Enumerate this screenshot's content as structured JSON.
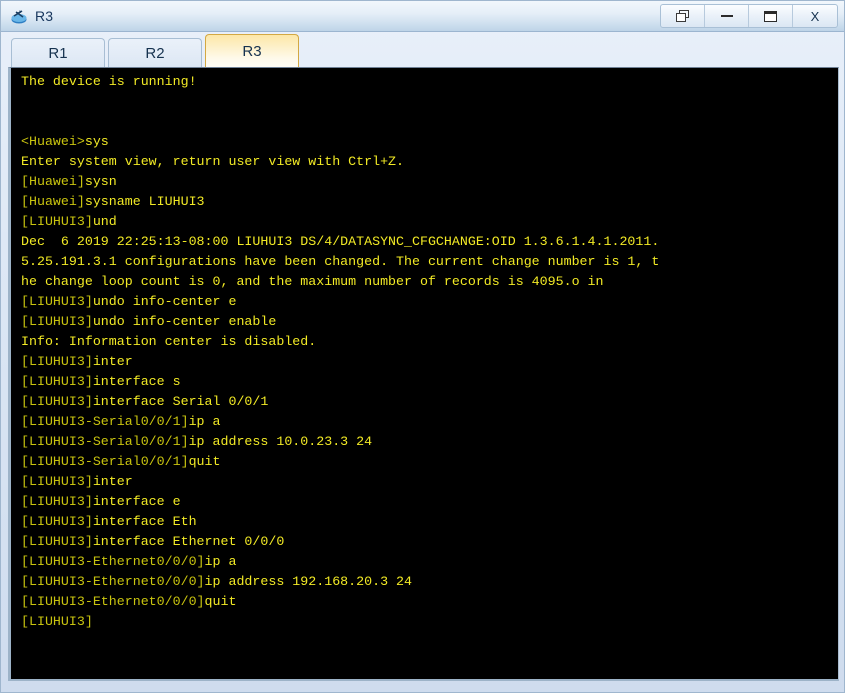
{
  "window": {
    "title": "R3",
    "icon": "router-icon",
    "controls": [
      {
        "name": "restore-button",
        "icon": "restore-icon",
        "label": ""
      },
      {
        "name": "minimize-button",
        "icon": "minimize-icon",
        "label": ""
      },
      {
        "name": "maximize-button",
        "icon": "maximize-icon",
        "label": ""
      },
      {
        "name": "close-button",
        "icon": "close-icon",
        "label": "X"
      }
    ]
  },
  "tabs": [
    {
      "label": "R1",
      "active": false
    },
    {
      "label": "R2",
      "active": false
    },
    {
      "label": "R3",
      "active": true
    }
  ],
  "terminal": {
    "colors": {
      "background": "#000000",
      "output_text": "#f2ea25",
      "prompt_text": "#c9c40f"
    },
    "lines": [
      {
        "type": "out",
        "text": "The device is running!"
      },
      {
        "type": "out",
        "text": ""
      },
      {
        "type": "out",
        "text": ""
      },
      {
        "type": "cmd",
        "prompt": "<Huawei>",
        "text": "sys"
      },
      {
        "type": "out",
        "text": "Enter system view, return user view with Ctrl+Z."
      },
      {
        "type": "cmd",
        "prompt": "[Huawei]",
        "text": "sysn"
      },
      {
        "type": "cmd",
        "prompt": "[Huawei]",
        "text": "sysname LIUHUI3"
      },
      {
        "type": "cmd",
        "prompt": "[LIUHUI3]",
        "text": "und"
      },
      {
        "type": "out",
        "text": "Dec  6 2019 22:25:13-08:00 LIUHUI3 DS/4/DATASYNC_CFGCHANGE:OID 1.3.6.1.4.1.2011."
      },
      {
        "type": "out",
        "text": "5.25.191.3.1 configurations have been changed. The current change number is 1, t"
      },
      {
        "type": "out",
        "text": "he change loop count is 0, and the maximum number of records is 4095.o in"
      },
      {
        "type": "cmd",
        "prompt": "[LIUHUI3]",
        "text": "undo info-center e"
      },
      {
        "type": "cmd",
        "prompt": "[LIUHUI3]",
        "text": "undo info-center enable"
      },
      {
        "type": "out",
        "text": "Info: Information center is disabled."
      },
      {
        "type": "cmd",
        "prompt": "[LIUHUI3]",
        "text": "inter"
      },
      {
        "type": "cmd",
        "prompt": "[LIUHUI3]",
        "text": "interface s"
      },
      {
        "type": "cmd",
        "prompt": "[LIUHUI3]",
        "text": "interface Serial 0/0/1"
      },
      {
        "type": "cmd",
        "prompt": "[LIUHUI3-Serial0/0/1]",
        "text": "ip a"
      },
      {
        "type": "cmd",
        "prompt": "[LIUHUI3-Serial0/0/1]",
        "text": "ip address 10.0.23.3 24"
      },
      {
        "type": "cmd",
        "prompt": "[LIUHUI3-Serial0/0/1]",
        "text": "quit"
      },
      {
        "type": "cmd",
        "prompt": "[LIUHUI3]",
        "text": "inter"
      },
      {
        "type": "cmd",
        "prompt": "[LIUHUI3]",
        "text": "interface e"
      },
      {
        "type": "cmd",
        "prompt": "[LIUHUI3]",
        "text": "interface Eth"
      },
      {
        "type": "cmd",
        "prompt": "[LIUHUI3]",
        "text": "interface Ethernet 0/0/0"
      },
      {
        "type": "cmd",
        "prompt": "[LIUHUI3-Ethernet0/0/0]",
        "text": "ip a"
      },
      {
        "type": "cmd",
        "prompt": "[LIUHUI3-Ethernet0/0/0]",
        "text": "ip address 192.168.20.3 24"
      },
      {
        "type": "cmd",
        "prompt": "[LIUHUI3-Ethernet0/0/0]",
        "text": "quit"
      },
      {
        "type": "cmd",
        "prompt": "[LIUHUI3]",
        "text": ""
      }
    ]
  }
}
